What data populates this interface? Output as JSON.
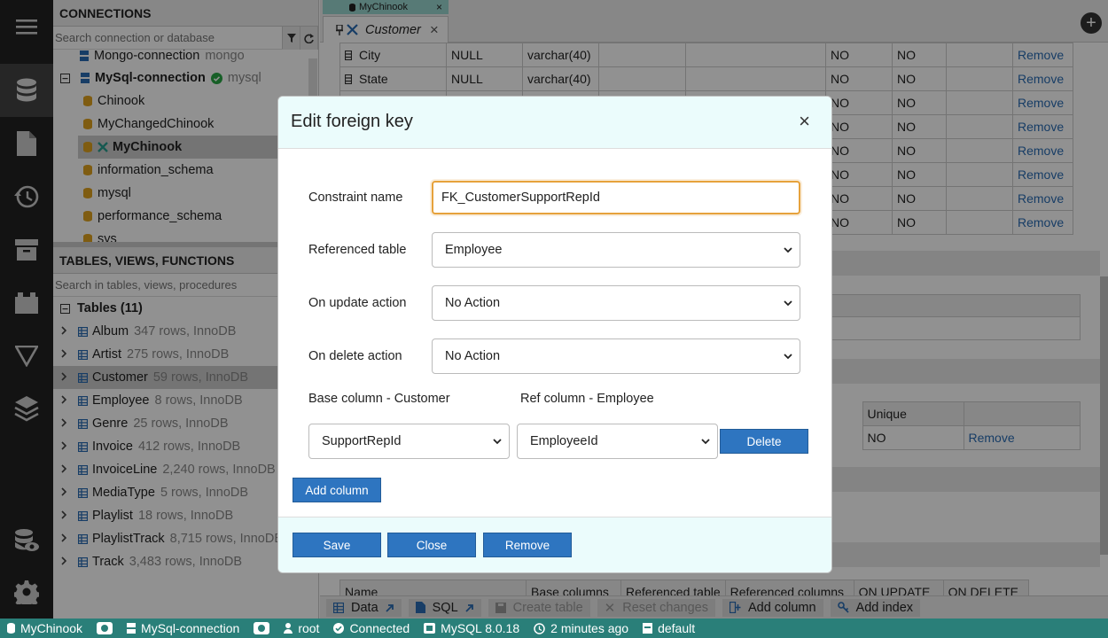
{
  "sidebar": {
    "connections_header": "CONNECTIONS",
    "conn_search_placeholder": "Search connection or database",
    "tree": [
      {
        "label": "Mongo-connection",
        "sub": "mongo"
      },
      {
        "label": "MySql-connection",
        "sub": "mysql"
      },
      {
        "label": "Chinook"
      },
      {
        "label": "MyChangedChinook"
      },
      {
        "label": "MyChinook"
      },
      {
        "label": "information_schema"
      },
      {
        "label": "mysql"
      },
      {
        "label": "performance_schema"
      },
      {
        "label": "sys"
      }
    ],
    "tables_header": "TABLES, VIEWS, FUNCTIONS",
    "tables_search_placeholder": "Search in tables, views, procedures",
    "tables_group": "Tables (11)",
    "tables": [
      {
        "name": "Album",
        "info": "347 rows, InnoDB"
      },
      {
        "name": "Artist",
        "info": "275 rows, InnoDB"
      },
      {
        "name": "Customer",
        "info": "59 rows, InnoDB"
      },
      {
        "name": "Employee",
        "info": "8 rows, InnoDB"
      },
      {
        "name": "Genre",
        "info": "25 rows, InnoDB"
      },
      {
        "name": "Invoice",
        "info": "412 rows, InnoDB"
      },
      {
        "name": "InvoiceLine",
        "info": "2,240 rows, InnoDB"
      },
      {
        "name": "MediaType",
        "info": "5 rows, InnoDB"
      },
      {
        "name": "Playlist",
        "info": "18 rows, InnoDB"
      },
      {
        "name": "PlaylistTrack",
        "info": "8,715 rows, InnoDB"
      },
      {
        "name": "Track",
        "info": "3,483 rows, InnoDB"
      }
    ]
  },
  "tabs": {
    "connection_tab": "MyChinook",
    "doc_tab": "Customer",
    "close": "×",
    "add": "+"
  },
  "content": {
    "columns_rows": [
      {
        "name": "City",
        "default": "NULL",
        "type": "varchar(40)",
        "c1": "NO",
        "c2": "NO",
        "action": "Remove"
      },
      {
        "name": "State",
        "default": "NULL",
        "type": "varchar(40)",
        "c1": "NO",
        "c2": "NO",
        "action": "Remove"
      },
      {
        "name": "",
        "default": "",
        "type": "",
        "c1": "NO",
        "c2": "NO",
        "action": "Remove"
      },
      {
        "name": "",
        "default": "",
        "type": "",
        "c1": "NO",
        "c2": "NO",
        "action": "Remove"
      },
      {
        "name": "",
        "default": "",
        "type": "",
        "c1": "NO",
        "c2": "NO",
        "action": "Remove"
      },
      {
        "name": "",
        "default": "",
        "type": "",
        "c1": "NO",
        "c2": "NO",
        "action": "Remove"
      },
      {
        "name": "",
        "default": "",
        "type": "",
        "c1": "NO",
        "c2": "NO",
        "action": "Remove"
      },
      {
        "name": "",
        "default": "",
        "type": "",
        "c1": "NO",
        "c2": "NO",
        "action": "Remove"
      }
    ],
    "index_header_unique": "Unique",
    "index_row_unique": "NO",
    "index_row_action": "Remove",
    "fk_headers": [
      "Name",
      "Base columns",
      "Referenced table",
      "Referenced columns",
      "ON UPDATE",
      "ON DELETE"
    ]
  },
  "toolbar": {
    "data": "Data",
    "sql": "SQL",
    "create_table": "Create table",
    "reset_changes": "Reset changes",
    "add_column": "Add column",
    "add_index": "Add index"
  },
  "status": {
    "db": "MyChinook",
    "connection": "MySql-connection",
    "user": "root",
    "state": "Connected",
    "server": "MySQL 8.0.18",
    "time": "2 minutes ago",
    "schema": "default"
  },
  "modal": {
    "title": "Edit foreign key",
    "close": "×",
    "constraint_label": "Constraint name",
    "constraint_value": "FK_CustomerSupportRepId",
    "ref_table_label": "Referenced table",
    "ref_table_value": "Employee",
    "on_update_label": "On update action",
    "on_update_value": "No Action",
    "on_delete_label": "On delete action",
    "on_delete_value": "No Action",
    "base_col_header": "Base column - Customer",
    "ref_col_header": "Ref column - Employee",
    "base_col_value": "SupportRepId",
    "ref_col_value": "EmployeeId",
    "delete_btn": "Delete",
    "add_column_btn": "Add column",
    "save_btn": "Save",
    "close_btn": "Close",
    "remove_btn": "Remove"
  },
  "colors": {
    "accent": "#2e75c0",
    "status_bar": "#2a7f79",
    "tab_accent": "#9ad6cf",
    "focus": "#e6a23c"
  }
}
